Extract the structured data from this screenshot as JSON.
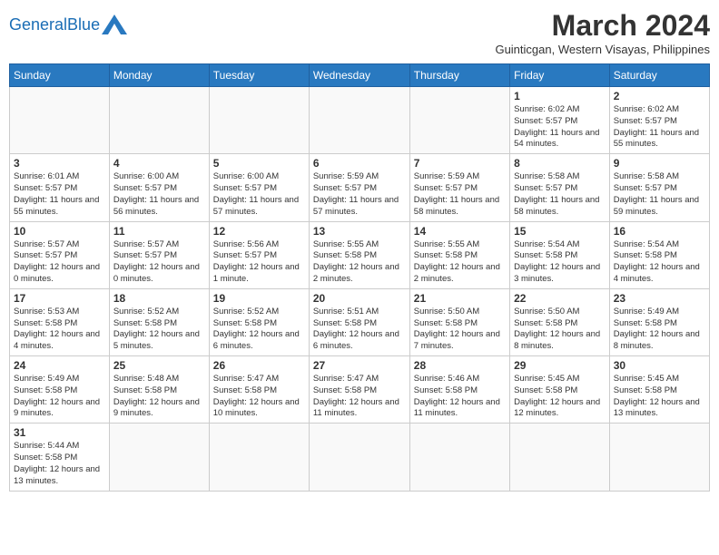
{
  "header": {
    "logo_general": "General",
    "logo_blue": "Blue",
    "month_year": "March 2024",
    "location": "Guinticgan, Western Visayas, Philippines"
  },
  "days_of_week": [
    "Sunday",
    "Monday",
    "Tuesday",
    "Wednesday",
    "Thursday",
    "Friday",
    "Saturday"
  ],
  "weeks": [
    [
      {
        "day": "",
        "info": ""
      },
      {
        "day": "",
        "info": ""
      },
      {
        "day": "",
        "info": ""
      },
      {
        "day": "",
        "info": ""
      },
      {
        "day": "",
        "info": ""
      },
      {
        "day": "1",
        "info": "Sunrise: 6:02 AM\nSunset: 5:57 PM\nDaylight: 11 hours\nand 54 minutes."
      },
      {
        "day": "2",
        "info": "Sunrise: 6:02 AM\nSunset: 5:57 PM\nDaylight: 11 hours\nand 55 minutes."
      }
    ],
    [
      {
        "day": "3",
        "info": "Sunrise: 6:01 AM\nSunset: 5:57 PM\nDaylight: 11 hours\nand 55 minutes."
      },
      {
        "day": "4",
        "info": "Sunrise: 6:00 AM\nSunset: 5:57 PM\nDaylight: 11 hours\nand 56 minutes."
      },
      {
        "day": "5",
        "info": "Sunrise: 6:00 AM\nSunset: 5:57 PM\nDaylight: 11 hours\nand 57 minutes."
      },
      {
        "day": "6",
        "info": "Sunrise: 5:59 AM\nSunset: 5:57 PM\nDaylight: 11 hours\nand 57 minutes."
      },
      {
        "day": "7",
        "info": "Sunrise: 5:59 AM\nSunset: 5:57 PM\nDaylight: 11 hours\nand 58 minutes."
      },
      {
        "day": "8",
        "info": "Sunrise: 5:58 AM\nSunset: 5:57 PM\nDaylight: 11 hours\nand 58 minutes."
      },
      {
        "day": "9",
        "info": "Sunrise: 5:58 AM\nSunset: 5:57 PM\nDaylight: 11 hours\nand 59 minutes."
      }
    ],
    [
      {
        "day": "10",
        "info": "Sunrise: 5:57 AM\nSunset: 5:57 PM\nDaylight: 12 hours\nand 0 minutes."
      },
      {
        "day": "11",
        "info": "Sunrise: 5:57 AM\nSunset: 5:57 PM\nDaylight: 12 hours\nand 0 minutes."
      },
      {
        "day": "12",
        "info": "Sunrise: 5:56 AM\nSunset: 5:57 PM\nDaylight: 12 hours\nand 1 minute."
      },
      {
        "day": "13",
        "info": "Sunrise: 5:55 AM\nSunset: 5:58 PM\nDaylight: 12 hours\nand 2 minutes."
      },
      {
        "day": "14",
        "info": "Sunrise: 5:55 AM\nSunset: 5:58 PM\nDaylight: 12 hours\nand 2 minutes."
      },
      {
        "day": "15",
        "info": "Sunrise: 5:54 AM\nSunset: 5:58 PM\nDaylight: 12 hours\nand 3 minutes."
      },
      {
        "day": "16",
        "info": "Sunrise: 5:54 AM\nSunset: 5:58 PM\nDaylight: 12 hours\nand 4 minutes."
      }
    ],
    [
      {
        "day": "17",
        "info": "Sunrise: 5:53 AM\nSunset: 5:58 PM\nDaylight: 12 hours\nand 4 minutes."
      },
      {
        "day": "18",
        "info": "Sunrise: 5:52 AM\nSunset: 5:58 PM\nDaylight: 12 hours\nand 5 minutes."
      },
      {
        "day": "19",
        "info": "Sunrise: 5:52 AM\nSunset: 5:58 PM\nDaylight: 12 hours\nand 6 minutes."
      },
      {
        "day": "20",
        "info": "Sunrise: 5:51 AM\nSunset: 5:58 PM\nDaylight: 12 hours\nand 6 minutes."
      },
      {
        "day": "21",
        "info": "Sunrise: 5:50 AM\nSunset: 5:58 PM\nDaylight: 12 hours\nand 7 minutes."
      },
      {
        "day": "22",
        "info": "Sunrise: 5:50 AM\nSunset: 5:58 PM\nDaylight: 12 hours\nand 8 minutes."
      },
      {
        "day": "23",
        "info": "Sunrise: 5:49 AM\nSunset: 5:58 PM\nDaylight: 12 hours\nand 8 minutes."
      }
    ],
    [
      {
        "day": "24",
        "info": "Sunrise: 5:49 AM\nSunset: 5:58 PM\nDaylight: 12 hours\nand 9 minutes."
      },
      {
        "day": "25",
        "info": "Sunrise: 5:48 AM\nSunset: 5:58 PM\nDaylight: 12 hours\nand 9 minutes."
      },
      {
        "day": "26",
        "info": "Sunrise: 5:47 AM\nSunset: 5:58 PM\nDaylight: 12 hours\nand 10 minutes."
      },
      {
        "day": "27",
        "info": "Sunrise: 5:47 AM\nSunset: 5:58 PM\nDaylight: 12 hours\nand 11 minutes."
      },
      {
        "day": "28",
        "info": "Sunrise: 5:46 AM\nSunset: 5:58 PM\nDaylight: 12 hours\nand 11 minutes."
      },
      {
        "day": "29",
        "info": "Sunrise: 5:45 AM\nSunset: 5:58 PM\nDaylight: 12 hours\nand 12 minutes."
      },
      {
        "day": "30",
        "info": "Sunrise: 5:45 AM\nSunset: 5:58 PM\nDaylight: 12 hours\nand 13 minutes."
      }
    ],
    [
      {
        "day": "31",
        "info": "Sunrise: 5:44 AM\nSunset: 5:58 PM\nDaylight: 12 hours\nand 13 minutes."
      },
      {
        "day": "",
        "info": ""
      },
      {
        "day": "",
        "info": ""
      },
      {
        "day": "",
        "info": ""
      },
      {
        "day": "",
        "info": ""
      },
      {
        "day": "",
        "info": ""
      },
      {
        "day": "",
        "info": ""
      }
    ]
  ]
}
